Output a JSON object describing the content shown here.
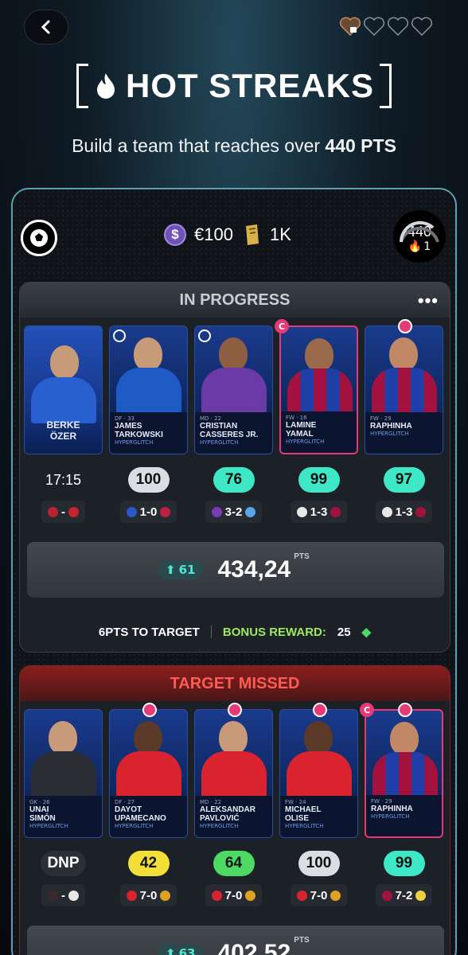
{
  "header": {
    "title": "HOT STREAKS",
    "subtitle_prefix": "Build a team that reaches over",
    "subtitle_target": "440 PTS",
    "lives": {
      "filled": 1,
      "total": 4
    }
  },
  "panel": {
    "coins": "€100",
    "tickets": "1K",
    "gauge_value": "440",
    "streak": "1"
  },
  "in_progress": {
    "title": "IN PROGRESS",
    "players": [
      {
        "first": "BERKE",
        "last": "ÖZER",
        "value": "17:15",
        "type": "time"
      },
      {
        "first": "JAMES",
        "last": "TARKOWSKI",
        "value": "100",
        "type": "white",
        "score": "1-0"
      },
      {
        "first": "CRISTIAN",
        "last": "CASSERES JR.",
        "value": "76",
        "type": "teal",
        "score": "3-2"
      },
      {
        "first": "LAMINE",
        "last": "YAMAL",
        "value": "99",
        "type": "teal",
        "score": "1-3"
      },
      {
        "first": "",
        "last": "RAPHINHA",
        "value": "97",
        "type": "teal",
        "score": "1-3"
      }
    ],
    "delta": "61",
    "total": "434,24",
    "total_unit": "PTS",
    "to_target": "6PTS TO TARGET",
    "bonus_label": "BONUS REWARD:",
    "bonus_value": "25"
  },
  "target_missed": {
    "title": "TARGET MISSED",
    "players": [
      {
        "first": "UNAI",
        "last": "SIMÓN",
        "value": "DNP",
        "type": "dark",
        "score": "-"
      },
      {
        "first": "DAYOT",
        "last": "UPAMECANO",
        "value": "42",
        "type": "yellow",
        "score": "7-0"
      },
      {
        "first": "ALEKSANDAR",
        "last": "PAVLOVIĆ",
        "value": "64",
        "type": "green",
        "score": "7-0"
      },
      {
        "first": "MICHAEL",
        "last": "OLISE",
        "value": "100",
        "type": "white",
        "score": "7-0"
      },
      {
        "first": "",
        "last": "RAPHINHA",
        "value": "99",
        "type": "teal",
        "score": "7-2"
      }
    ],
    "delta": "63",
    "total": "402,52",
    "total_unit": "PTS"
  },
  "colors": {
    "accent": "#3ee8c6",
    "captain": "#e63a78",
    "missed": "#ff5b52"
  }
}
